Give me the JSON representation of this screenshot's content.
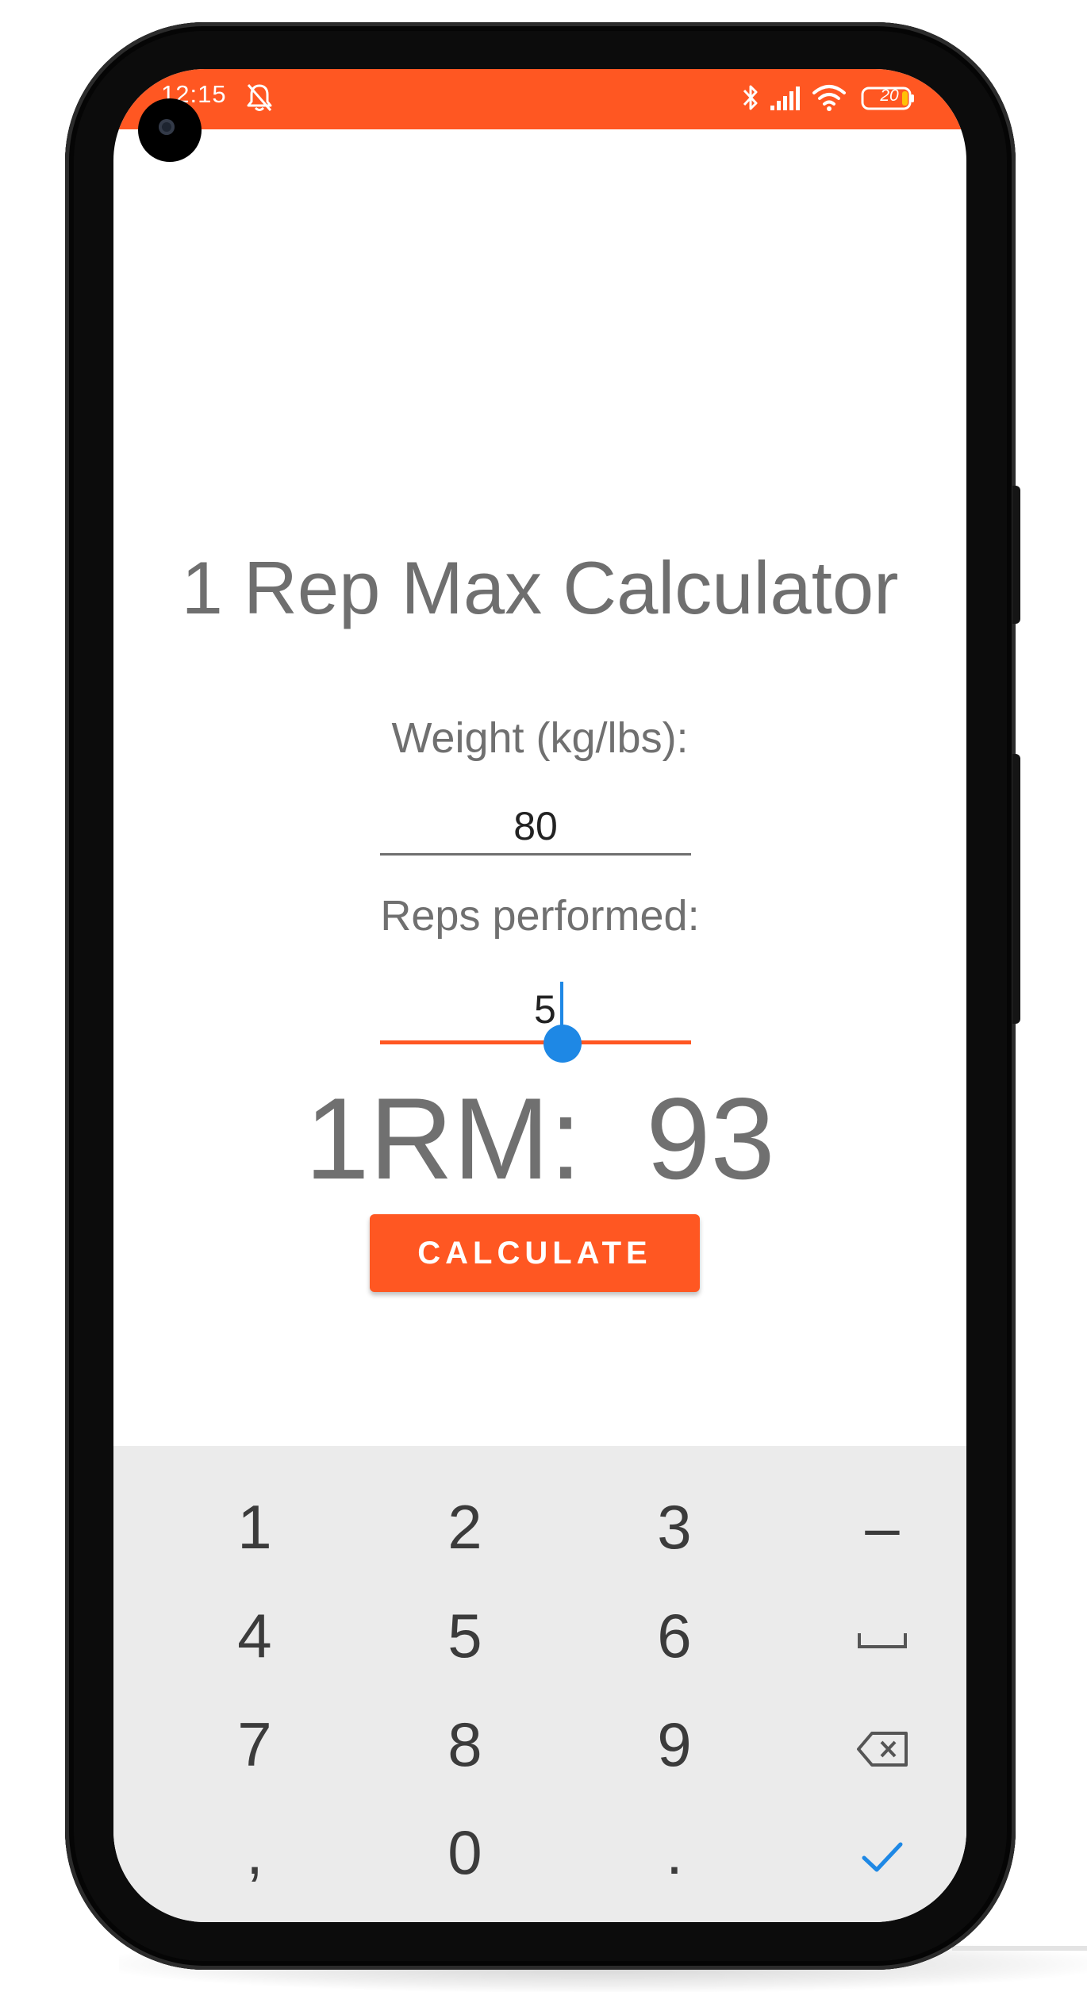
{
  "status_bar": {
    "time": "12:15",
    "battery": "20",
    "bar_color": "#ff5722",
    "icons": [
      "bell-off-icon",
      "bluetooth-icon",
      "signal-icon",
      "wifi-icon",
      "battery-icon"
    ]
  },
  "app": {
    "title": "1 Rep Max Calculator",
    "weight_label": "Weight (kg/lbs):",
    "weight_value": "80",
    "reps_label": "Reps performed:",
    "reps_value": "5",
    "result": "1RM:  93",
    "calculate_label": "CALCULATE",
    "accent_color": "#ff5722",
    "thumb_color": "#1e88e5"
  },
  "keyboard": {
    "keys": {
      "k1": "1",
      "k2": "2",
      "k3": "3",
      "minus": "–",
      "k4": "4",
      "k5": "5",
      "k6": "6",
      "k7": "7",
      "k8": "8",
      "k9": "9",
      "comma": ",",
      "k0": "0",
      "period": "."
    },
    "icons": [
      "space-icon",
      "backspace-icon",
      "check-icon"
    ]
  }
}
